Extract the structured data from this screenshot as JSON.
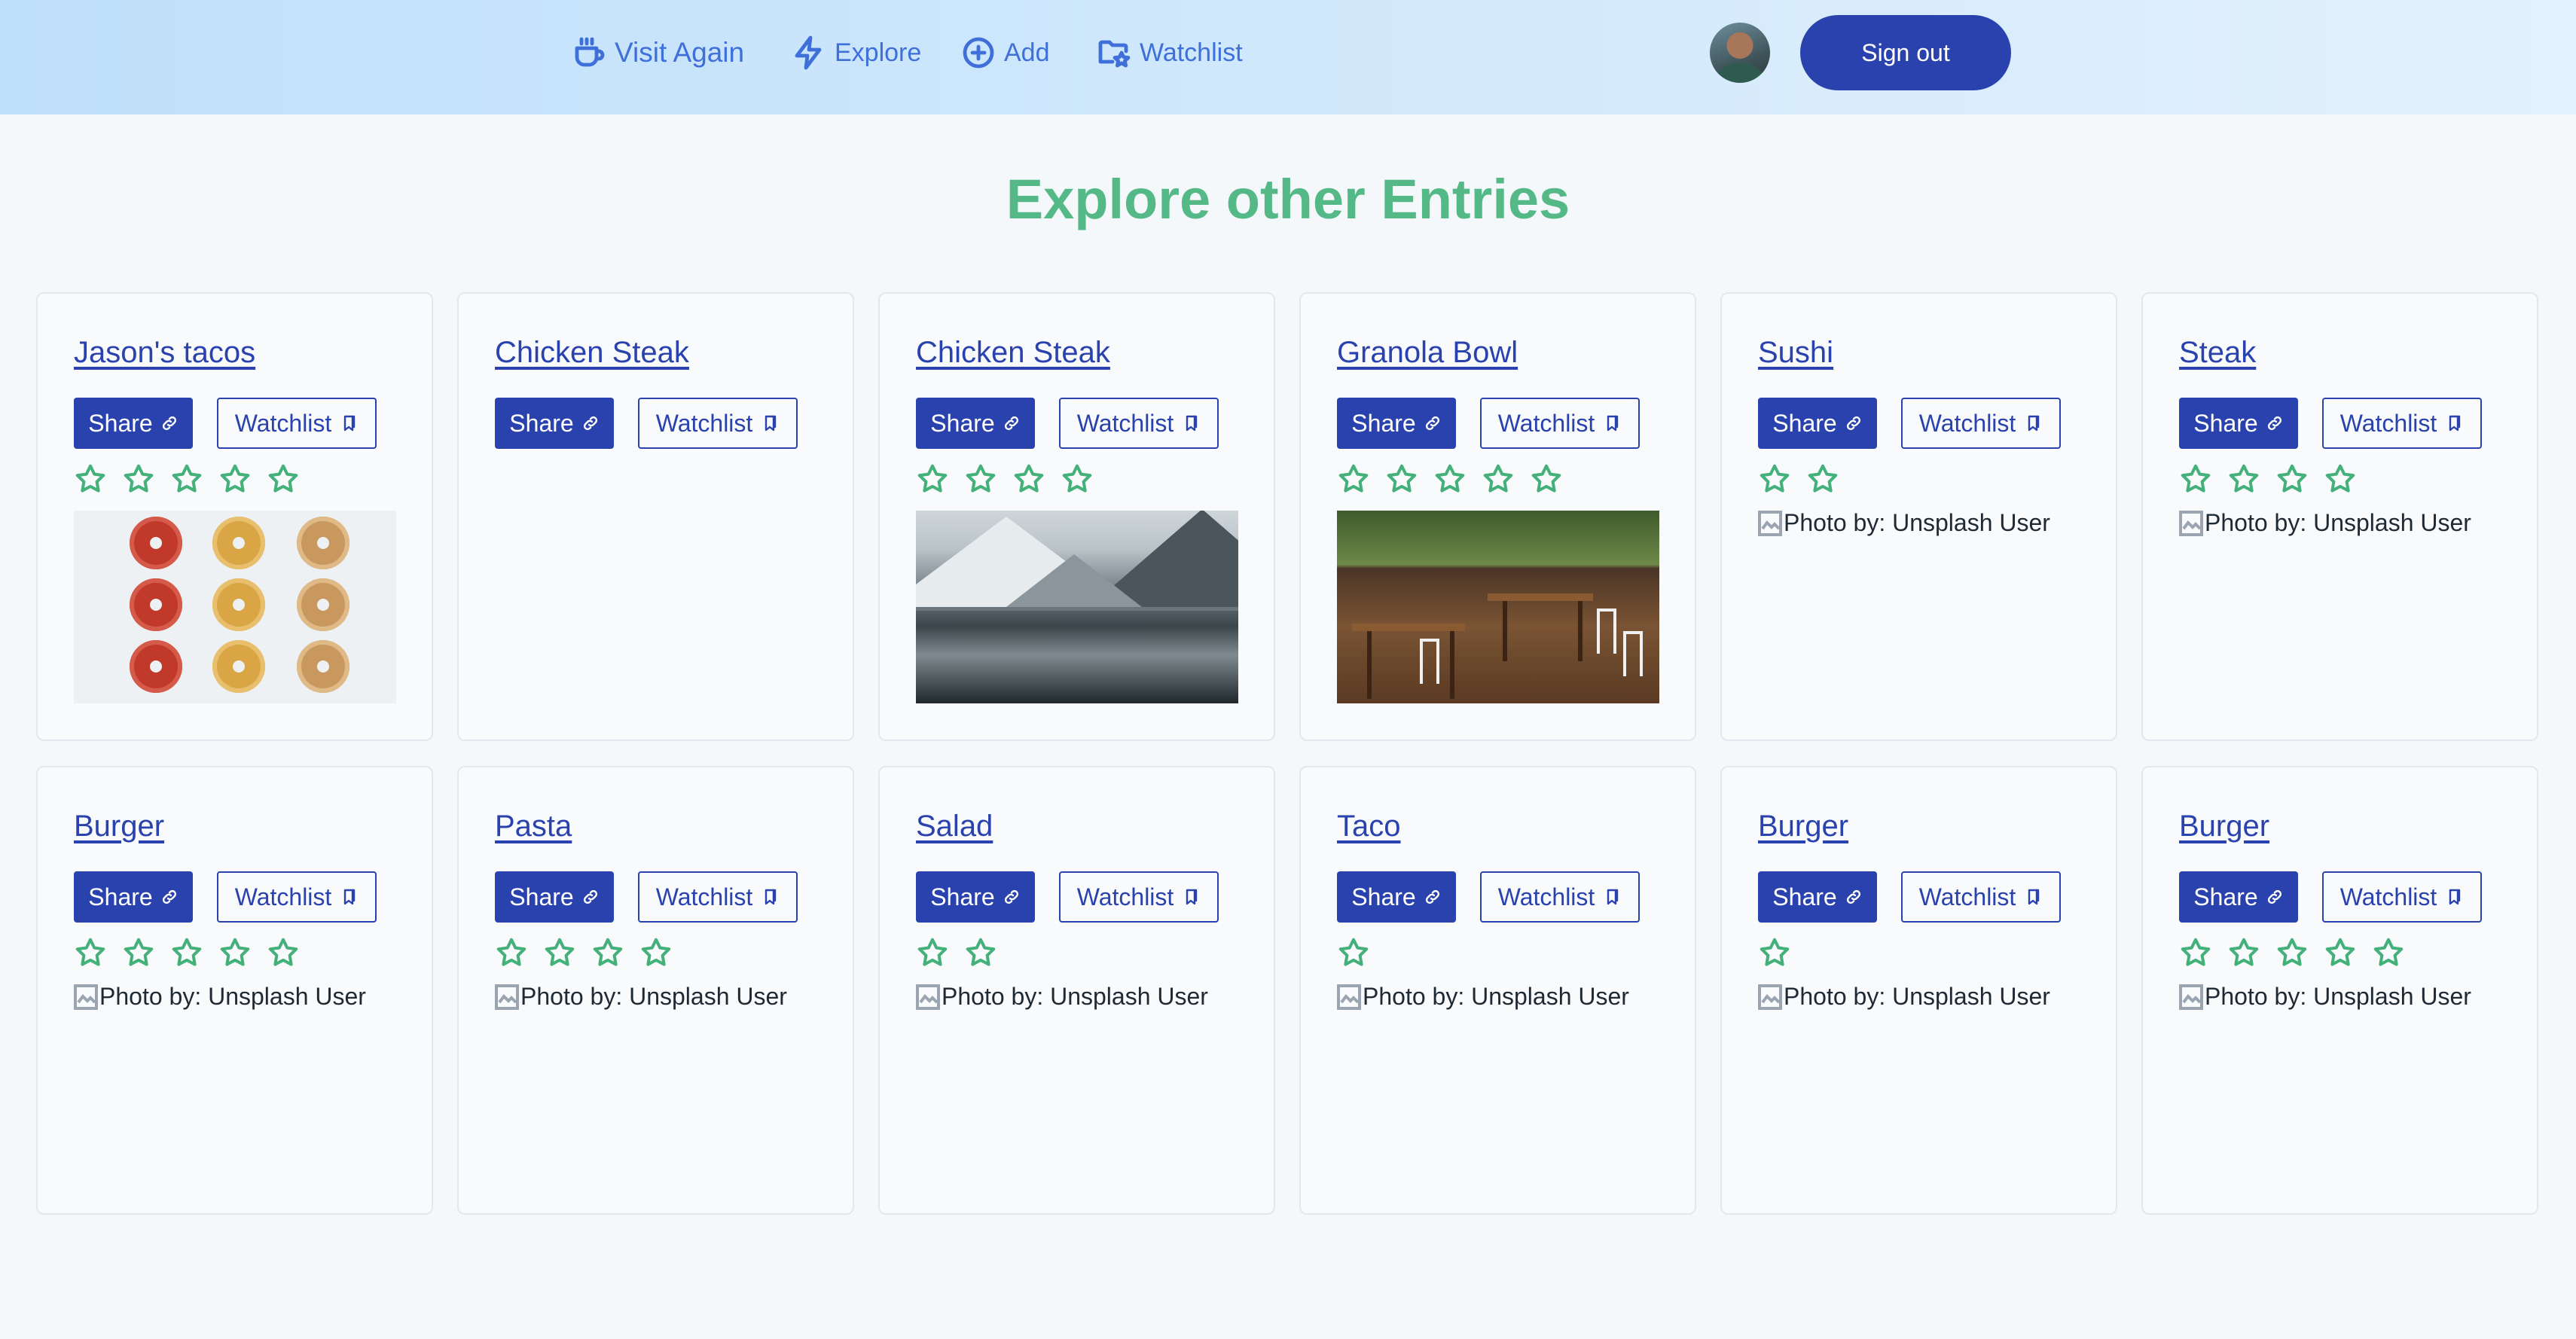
{
  "nav": {
    "items": [
      {
        "label": "Visit Again",
        "icon": "coffee-cup-icon"
      },
      {
        "label": "Explore",
        "icon": "lightning-icon"
      },
      {
        "label": "Add",
        "icon": "plus-circle-icon"
      },
      {
        "label": "Watchlist",
        "icon": "folder-star-icon"
      }
    ],
    "sign_out_label": "Sign out"
  },
  "heading": "Explore other Entries",
  "share_label": "Share",
  "watchlist_label": "Watchlist",
  "photo_alt": "Photo by: Unsplash User",
  "colors": {
    "accent": "#2a42ad",
    "heading_green": "#55b987",
    "star_green": "#44b07a",
    "nav_link": "#3f6fd8"
  },
  "entries": [
    {
      "title": "Jason's tacos",
      "rating": 5,
      "image": "donuts-photo"
    },
    {
      "title": "Chicken Steak",
      "rating": 0,
      "image": "none"
    },
    {
      "title": "Chicken Steak",
      "rating": 4,
      "image": "mountain-lake-photo"
    },
    {
      "title": "Granola Bowl",
      "rating": 5,
      "image": "cafe-terrace-photo"
    },
    {
      "title": "Sushi",
      "rating": 2,
      "image": "broken"
    },
    {
      "title": "Steak",
      "rating": 4,
      "image": "broken"
    },
    {
      "title": "Burger",
      "rating": 5,
      "image": "broken"
    },
    {
      "title": "Pasta",
      "rating": 4,
      "image": "broken"
    },
    {
      "title": "Salad",
      "rating": 2,
      "image": "broken"
    },
    {
      "title": "Taco",
      "rating": 1,
      "image": "broken"
    },
    {
      "title": "Burger",
      "rating": 1,
      "image": "broken"
    },
    {
      "title": "Burger",
      "rating": 5,
      "image": "broken"
    }
  ]
}
